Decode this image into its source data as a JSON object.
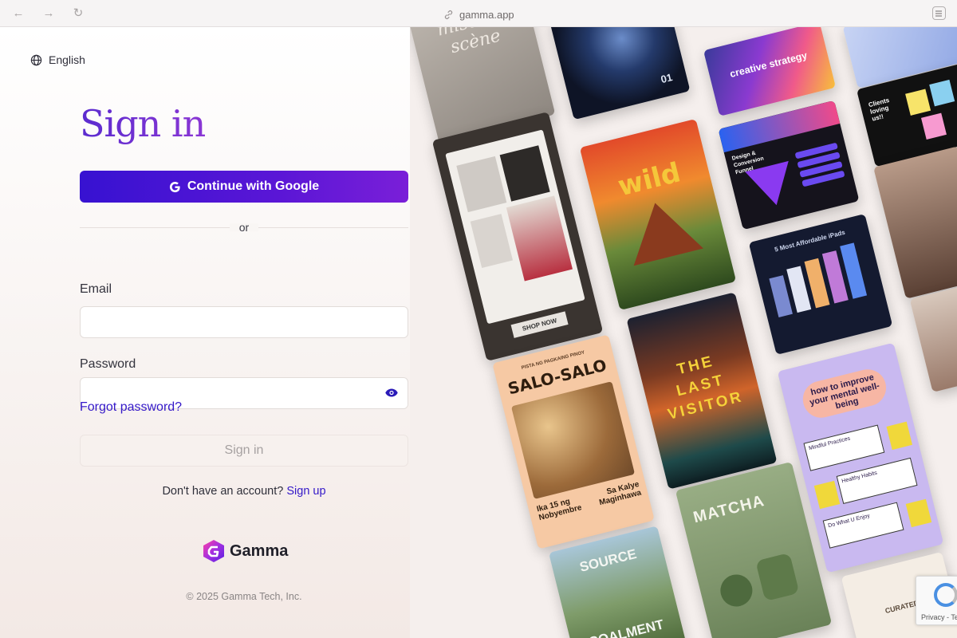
{
  "browser": {
    "url": "gamma.app"
  },
  "language": {
    "label": "English"
  },
  "form": {
    "title": "Sign in",
    "google_button": "Continue with Google",
    "divider": "or",
    "email_label": "Email",
    "email_value": "",
    "password_label": "Password",
    "password_value": "",
    "forgot_password": "Forgot password?",
    "signin_button": "Sign in",
    "no_account": "Don't have an account?",
    "signup_link": "Sign up"
  },
  "footer": {
    "brand": "Gamma",
    "copyright": "© 2025 Gamma Tech, Inc."
  },
  "gallery": {
    "cards": [
      {
        "title": "mise en scène"
      },
      {
        "title": "01"
      },
      {
        "title": "creative strategy"
      },
      {
        "title": "Clients loving us!!"
      },
      {
        "title": "Design & Conversion Funnel"
      },
      {
        "title": "wild"
      },
      {
        "title": "SHOP NOW"
      },
      {
        "title": "5 Most Affordable iPads"
      },
      {
        "title": "THE LAST VISITOR"
      },
      {
        "title": "SALO-SALO"
      },
      {
        "title": "PISTA NG PAGKAING PINOY"
      },
      {
        "title": "Ika 15 ng Nobyembre"
      },
      {
        "title": "Sa Kalye Maginhawa"
      },
      {
        "title": "how to improve your mental well-being"
      },
      {
        "title": "Mindful Practices"
      },
      {
        "title": "Healthy Habits"
      },
      {
        "title": "Do What U Enjoy"
      },
      {
        "title": "MATCHA"
      },
      {
        "title": "SOURCE"
      },
      {
        "title": "COALMENT"
      },
      {
        "title": "CURATED"
      }
    ]
  },
  "recaptcha": {
    "text": "Privacy - Te"
  },
  "colors": {
    "accent": "#3418c8",
    "button_gradient_start": "#3712d1",
    "button_gradient_end": "#7a1fd8"
  }
}
